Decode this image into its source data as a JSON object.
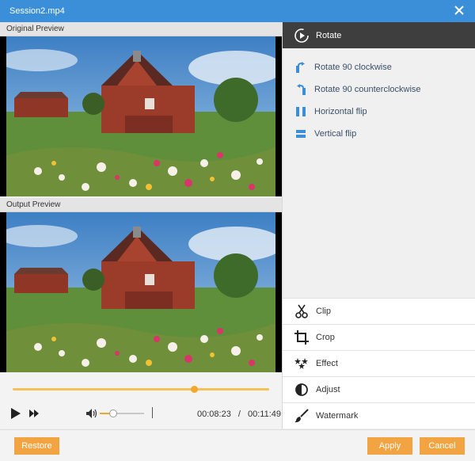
{
  "window": {
    "title": "Session2.mp4"
  },
  "preview": {
    "original_label": "Original Preview",
    "output_label": "Output Preview"
  },
  "playback": {
    "current_time": "00:08:23",
    "total_time": "00:11:49",
    "time_separator": "/",
    "progress": 0.708,
    "volume": 0.3
  },
  "rotate": {
    "header_label": "Rotate",
    "items": [
      {
        "label": "Rotate 90 clockwise",
        "icon": "rotate-clockwise-icon"
      },
      {
        "label": "Rotate 90 counterclockwise",
        "icon": "rotate-counterclockwise-icon"
      },
      {
        "label": "Horizontal flip",
        "icon": "horizontal-flip-icon"
      },
      {
        "label": "Vertical flip",
        "icon": "vertical-flip-icon"
      }
    ]
  },
  "tools": [
    {
      "label": "Clip",
      "icon": "scissors-icon"
    },
    {
      "label": "Crop",
      "icon": "crop-icon"
    },
    {
      "label": "Effect",
      "icon": "effect-icon"
    },
    {
      "label": "Adjust",
      "icon": "adjust-icon"
    },
    {
      "label": "Watermark",
      "icon": "brush-icon"
    }
  ],
  "footer": {
    "restore_label": "Restore",
    "apply_label": "Apply",
    "cancel_label": "Cancel"
  },
  "colors": {
    "titlebar": "#3b8fd9",
    "accent": "#f2a442",
    "rotate_header": "#3e3e3e",
    "rotate_icon": "#3b8fd9"
  }
}
